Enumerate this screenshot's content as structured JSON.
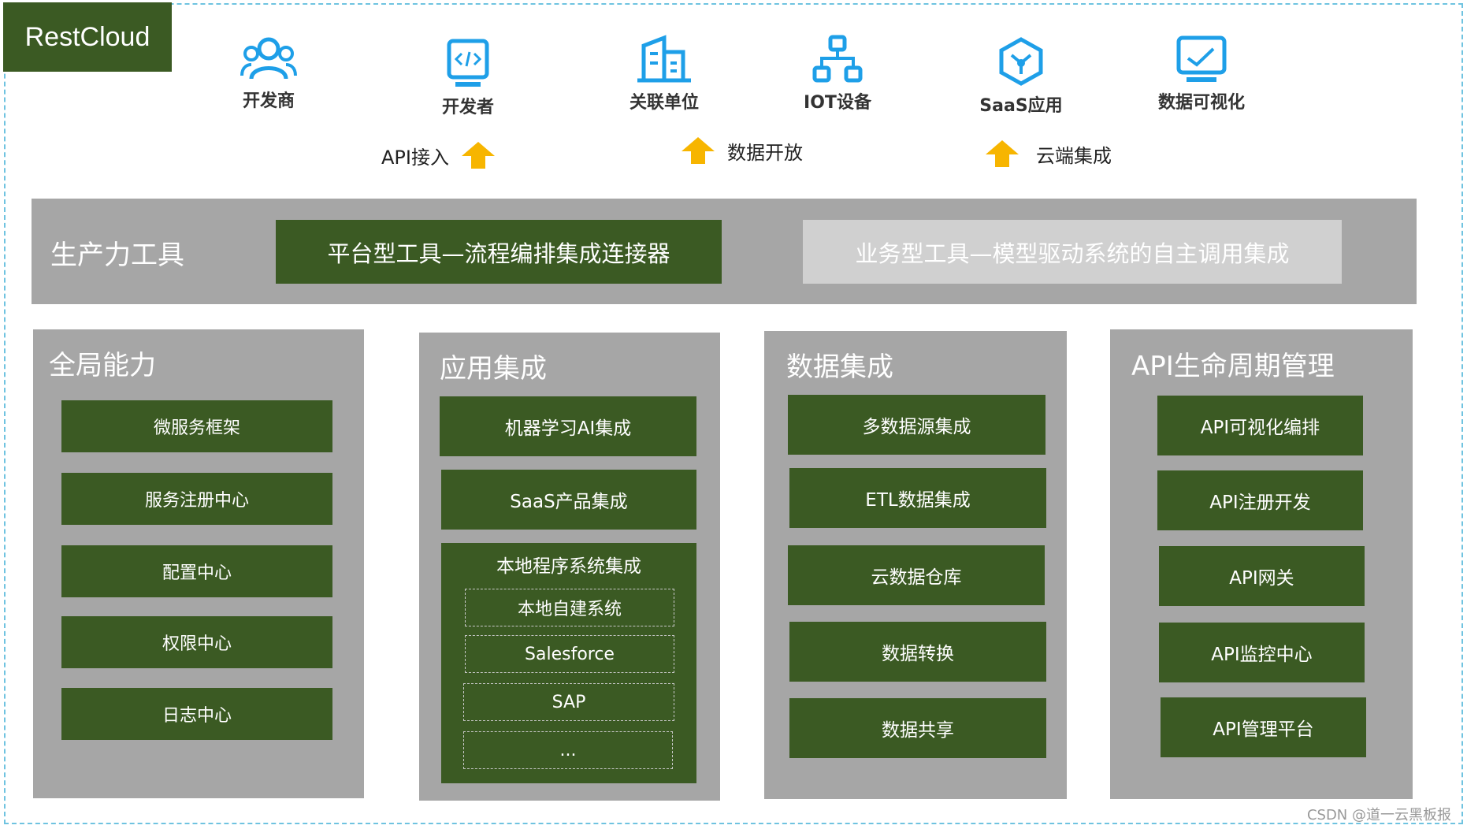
{
  "brand": "RestCloud",
  "roles": [
    {
      "label": "开发商",
      "icon": "users-icon"
    },
    {
      "label": "开发者",
      "icon": "code-window-icon"
    },
    {
      "label": "关联单位",
      "icon": "building-icon"
    },
    {
      "label": "IOT设备",
      "icon": "network-tree-icon"
    },
    {
      "label": "SaaS应用",
      "icon": "cube-hub-icon"
    },
    {
      "label": "数据可视化",
      "icon": "chart-monitor-icon"
    }
  ],
  "flows": {
    "api_access": "API接入",
    "data_open": "数据开放",
    "cloud_integration": "云端集成"
  },
  "productivity": {
    "title": "生产力工具",
    "platform_tool": "平台型工具—流程编排集成连接器",
    "business_tool": "业务型工具—模型驱动系统的自主调用集成"
  },
  "columns": {
    "global": {
      "title": "全局能力",
      "items": [
        "微服务框架",
        "服务注册中心",
        "配置中心",
        "权限中心",
        "日志中心"
      ]
    },
    "app": {
      "title": "应用集成",
      "items": [
        "机器学习AI集成",
        "SaaS产品集成"
      ],
      "local": {
        "title": "本地程序系统集成",
        "subitems": [
          "本地自建系统",
          "Salesforce",
          "SAP",
          "..."
        ]
      }
    },
    "data": {
      "title": "数据集成",
      "items": [
        "多数据源集成",
        "ETL数据集成",
        "云数据仓库",
        "数据转换",
        "数据共享"
      ]
    },
    "api": {
      "title": "API生命周期管理",
      "items": [
        "API可视化编排",
        "API注册开发",
        "API网关",
        "API监控中心",
        "API管理平台"
      ]
    }
  },
  "colors": {
    "dark_green": "#3b5a23",
    "gray_panel": "#a6a6a6",
    "light_gray": "#d0d0d0",
    "icon_blue": "#1e9fe8",
    "arrow_yellow": "#f7b500",
    "border_blue": "#6fc3e0"
  },
  "watermark": "CSDN @道一云黑板报"
}
